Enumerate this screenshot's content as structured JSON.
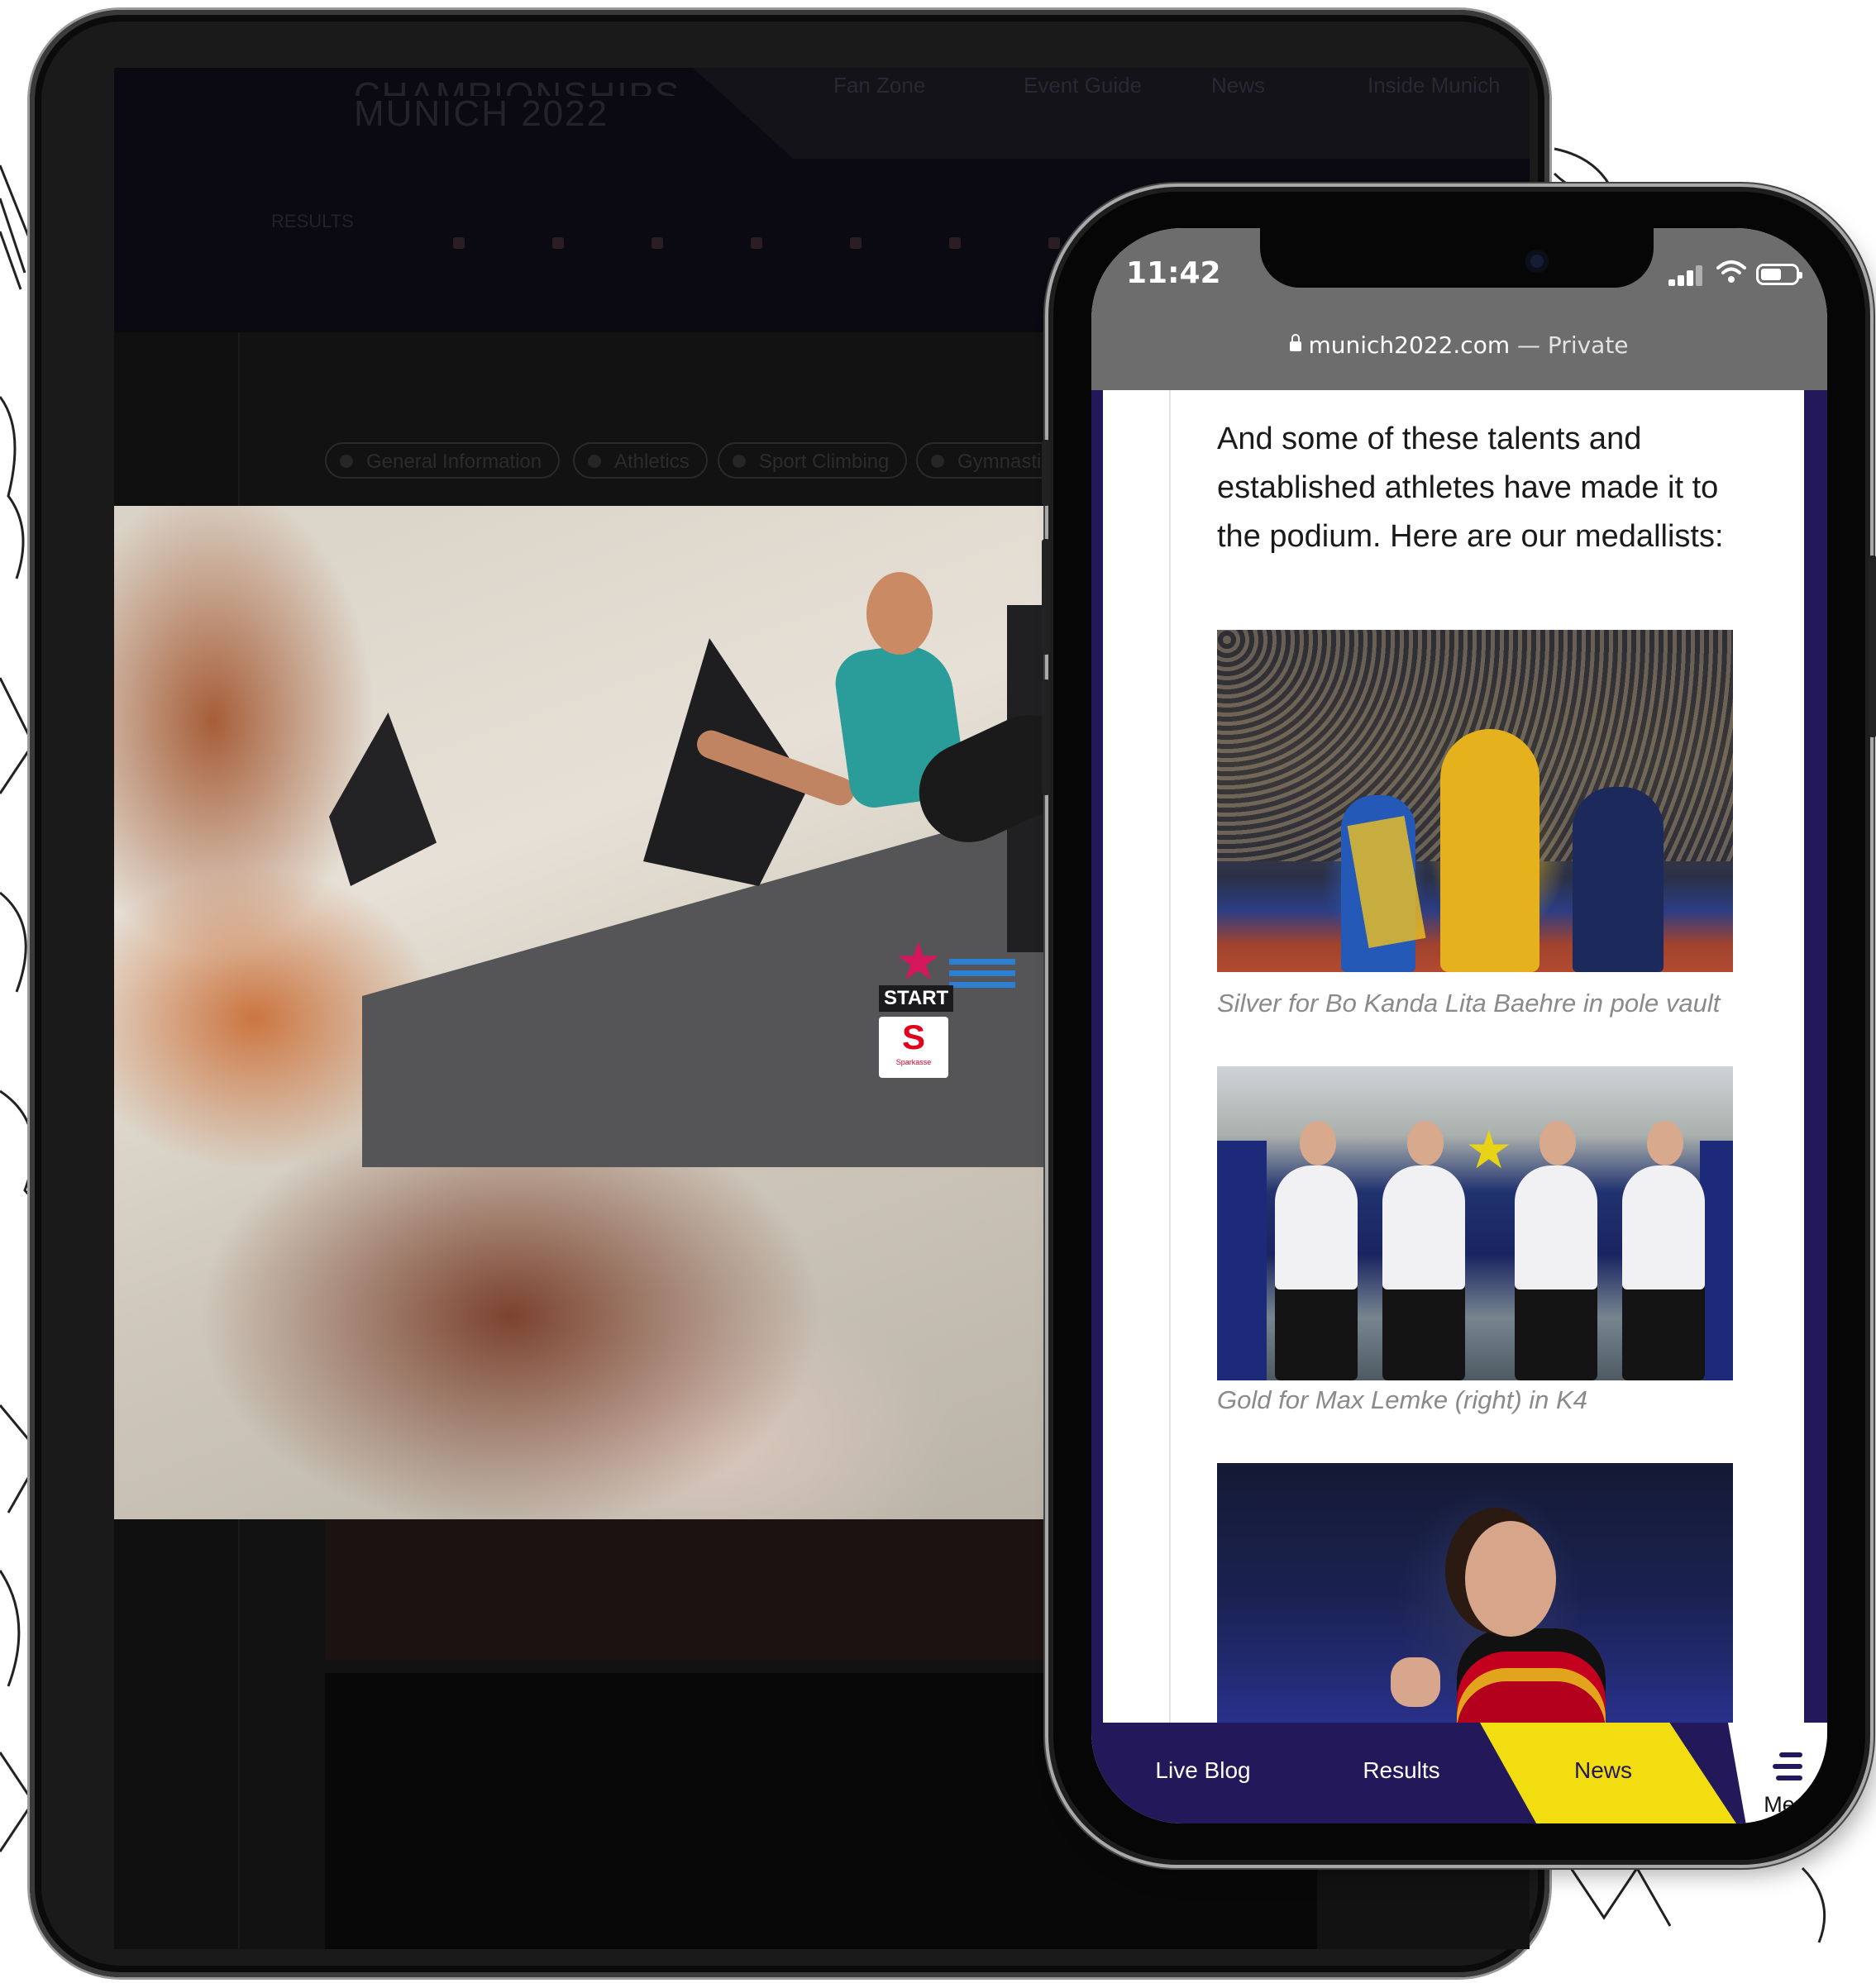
{
  "tablet": {
    "logo_line1": "CHAMPIONSHIPS",
    "logo_line2": "MUNICH 2022",
    "nav": [
      "Fan Zone",
      "Event Guide",
      "News",
      "Inside Munich"
    ],
    "results_label": "RESULTS",
    "filter_pills": [
      "General Information",
      "Athletics",
      "Sport Climbing",
      "Gymnastics"
    ],
    "photo": {
      "start_label": "START",
      "sponsor_mark": "S",
      "sponsor_name": "Sparkasse"
    }
  },
  "phone": {
    "status": {
      "time": "11:42"
    },
    "browser": {
      "domain": "munich2022.com",
      "suffix": "— Private"
    },
    "article": {
      "intro": "And some of these talents and established athletes have made it to the podium. Here are our medallists:",
      "captions": [
        "Silver for Bo Kanda Lita Baehre in pole vault",
        "Gold for Max Lemke (right) in K4"
      ]
    },
    "tabbar": {
      "items": [
        "Live Blog",
        "Results",
        "News",
        "Menu"
      ],
      "active": "News"
    }
  },
  "colors": {
    "brand_purple": "#22185a",
    "news_yellow": "#f1dd10",
    "browser_bar": "#6d6d6e"
  }
}
